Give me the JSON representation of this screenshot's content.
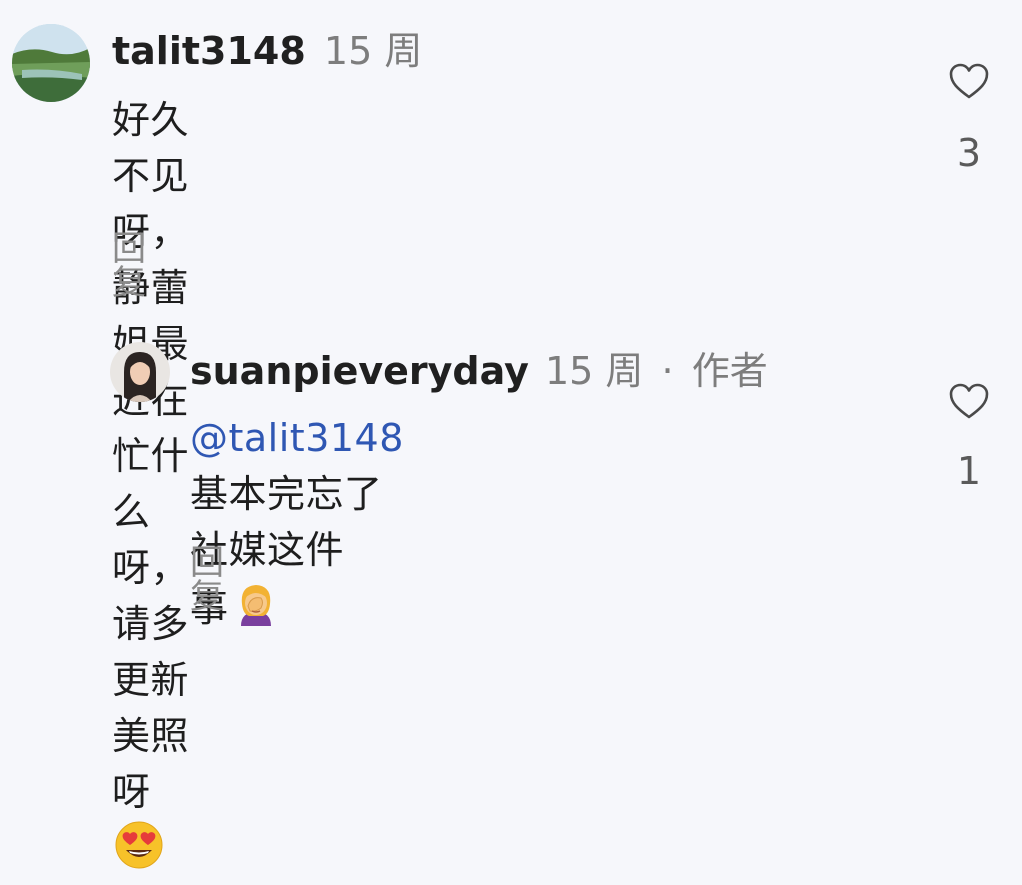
{
  "comments": [
    {
      "username": "talit3148",
      "time": "15 周",
      "text_line1": "好久不见呀，静蕾姐最近在忙什么",
      "text_line2": "呀，请多更新美照呀",
      "emoji": "heart-eyes-face",
      "reply_label": "回复",
      "likes": "3"
    },
    {
      "username": "suanpieveryday",
      "time": "15 周",
      "separator": "·",
      "author_badge": "作者",
      "mention": "@talit3148",
      "text_line1_rest": " 基本完忘了社媒这件",
      "text_line2": "事",
      "emoji": "woman-facepalming",
      "reply_label": "回复",
      "likes": "1"
    }
  ],
  "colors": {
    "mention": "#2f57b3",
    "muted": "#7d7d7d",
    "background": "#f6f7fb"
  }
}
